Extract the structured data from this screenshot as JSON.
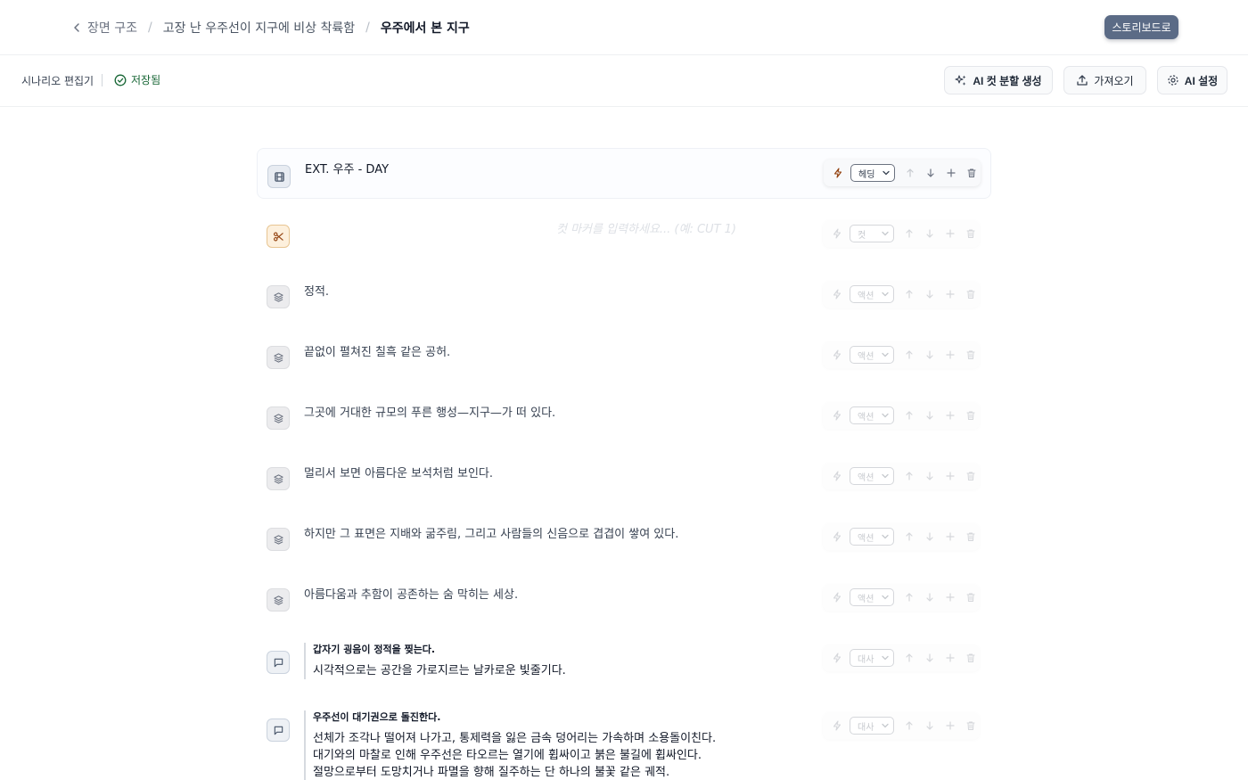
{
  "breadcrumb": {
    "back": "장면 구조",
    "parent": "고장 난 우주선이 지구에 비상 착륙함",
    "current": "우주에서 본 지구",
    "separator": "/"
  },
  "header": {
    "storyboard_button": "스토리보드로"
  },
  "toolbar": {
    "editor_title": "시나리오 편집기",
    "saved_label": "저장됨",
    "ai_cut_button": "AI 컷 분할 생성",
    "import_button": "가져오기",
    "ai_settings_button": "AI 설정"
  },
  "cut_placeholder": "컷 마커를 입력하세요... (예: CUT 1)",
  "blocks": [
    {
      "kind": "heading",
      "type_label": "헤딩",
      "text": "EXT. 우주 - DAY"
    },
    {
      "kind": "cut",
      "type_label": "컷",
      "text": ""
    },
    {
      "kind": "action",
      "type_label": "액션",
      "text": "정적."
    },
    {
      "kind": "action",
      "type_label": "액션",
      "text": "끝없이 펼쳐진 칠흑 같은 공허."
    },
    {
      "kind": "action",
      "type_label": "액션",
      "text": "그곳에 거대한 규모의 푸른 행성—지구—가 떠 있다."
    },
    {
      "kind": "action",
      "type_label": "액션",
      "text": "멀리서 보면 아름다운 보석처럼 보인다."
    },
    {
      "kind": "action",
      "type_label": "액션",
      "text": "하지만 그 표면은 지배와 굶주림, 그리고 사람들의 신음으로 겹겹이 쌓여 있다."
    },
    {
      "kind": "action",
      "type_label": "액션",
      "text": "아름다움과 추함이 공존하는 숨 막히는 세상."
    },
    {
      "kind": "dialogue",
      "type_label": "대사",
      "speaker": "갑자기 굉음이 정적을 찢는다.",
      "lines": [
        "시각적으로는 공간을 가로지르는 날카로운 빛줄기다."
      ]
    },
    {
      "kind": "dialogue",
      "type_label": "대사",
      "speaker": "우주선이 대기권으로 돌진한다.",
      "lines": [
        "선체가 조각나 떨어져 나가고, 통제력을 잃은 금속 덩어리는 가속하며 소용돌이친다.",
        "대기와의 마찰로 인해 우주선은 타오르는 열기에 휩싸이고 붉은 불길에 휩싸인다.",
        "절망으로부터 도망치거나 파멸을 향해 질주하는 단 하나의 불꽃 같은 궤적."
      ]
    }
  ]
}
